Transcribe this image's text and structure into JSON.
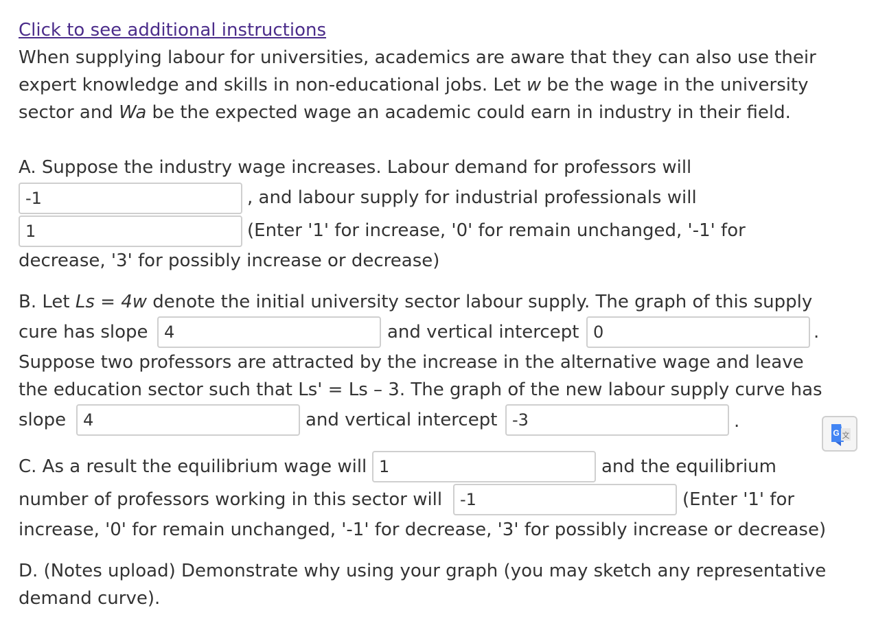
{
  "instructions_link": "Click to see additional instructions",
  "intro": {
    "l1": "When supplying labour for universities, academics are aware that they can also use their",
    "l2a": "expert knowledge and skills in non-educational jobs. Let ",
    "l2w": "w",
    "l2b": " be the wage in the university",
    "l3a": "sector and ",
    "l3wa": "Wa",
    "l3b": " be the expected wage an academic could earn in industry in their field."
  },
  "partA": {
    "l1": "A. Suppose the industry wage increases. Labour demand for professors will",
    "input1": "-1",
    "after1": ", and labour supply for industrial professionals will",
    "input2": "1",
    "after2": "(Enter '1' for increase, '0' for remain unchanged, '-1' for",
    "l4": "decrease, '3' for possibly increase or decrease)"
  },
  "partB": {
    "l1a": "B. Let ",
    "l1eq": "Ls = 4w",
    "l1b": " denote the initial university sector labour supply. The graph of this supply",
    "l2a": "cure has slope",
    "slope1": "4",
    "l2b": "and vertical intercept",
    "intercept1": "0",
    "l3": "Suppose two professors are attracted by the increase in the alternative wage and leave",
    "l4": "the education sector such that Ls' = Ls – 3. The graph of the new labour supply curve has",
    "l5a": "slope",
    "slope2": "4",
    "l5b": "and vertical intercept",
    "intercept2": "-3",
    "period": "."
  },
  "partC": {
    "l1a": "C. As a result the equilibrium wage will",
    "wage": "1",
    "l1b": "and the equilibrium",
    "l2a": "number of professors working in this sector will",
    "number": "-1",
    "l2b": "(Enter '1' for",
    "l3": "increase, '0' for remain unchanged, '-1' for decrease, '3' for possibly increase or decrease)"
  },
  "partD": {
    "l1": "D. (Notes upload) Demonstrate why using your graph (you may sketch any representative",
    "l2": "demand curve)."
  },
  "colors": {
    "link": "#4b2c8a",
    "text": "#333333",
    "border": "#cfcfcf",
    "google_blue": "#4285f4"
  },
  "icons": {
    "translate": "google-translate-icon"
  }
}
